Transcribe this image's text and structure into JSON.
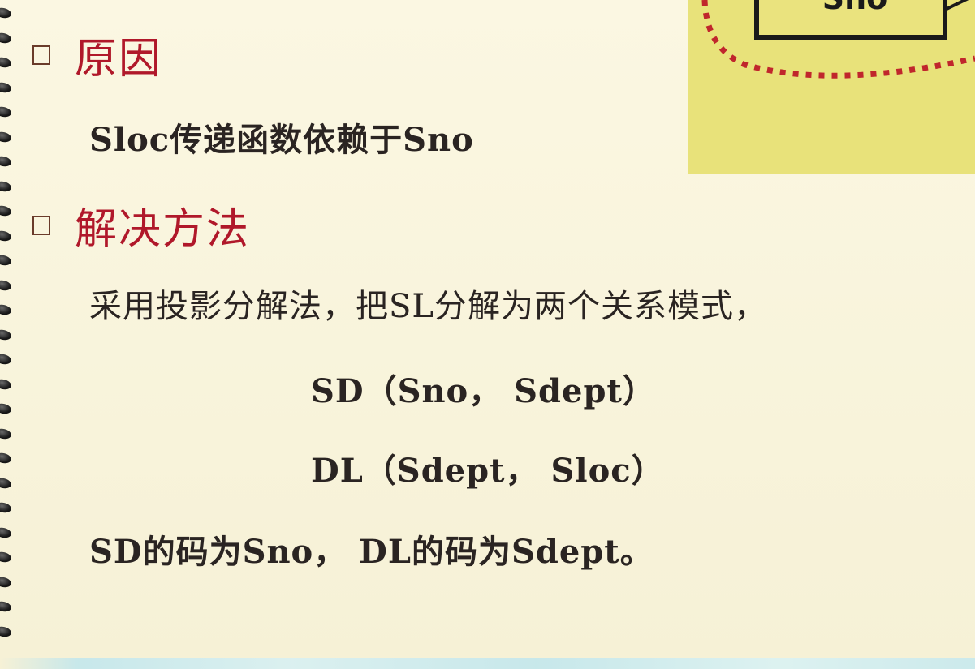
{
  "diagram": {
    "box_label": "Sno"
  },
  "sections": [
    {
      "title": "原因",
      "lines": [
        "Sloc传递函数依赖于Sno"
      ]
    },
    {
      "title": "解决方法",
      "lines": [
        "采用投影分解法，把SL分解为两个关系模式，",
        "SD（Sno， Sdept）",
        "DL（Sdept， Sloc）",
        "SD的码为Sno， DL的码为Sdept。"
      ]
    }
  ],
  "colors": {
    "background": "#f8f4dc",
    "heading": "#b0182a",
    "body": "#2a2422",
    "diagram_fill": "#e8e27a",
    "dotted_border": "#c0262c"
  }
}
